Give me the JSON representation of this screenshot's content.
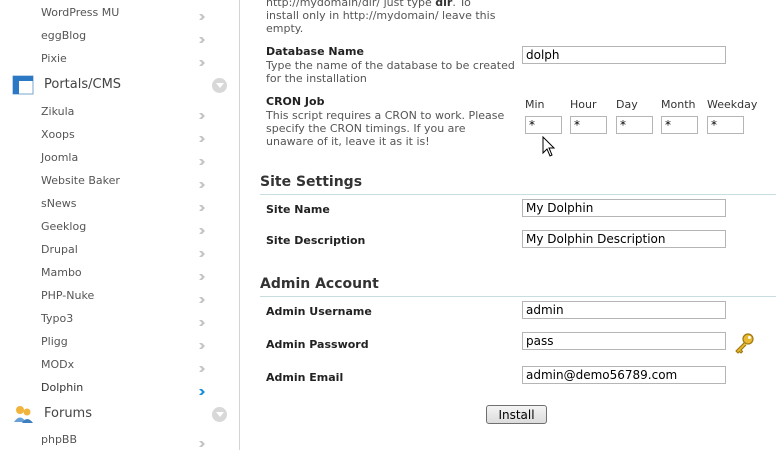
{
  "sidebar": {
    "items_top": [
      {
        "label": "WordPress MU"
      },
      {
        "label": "eggBlog"
      },
      {
        "label": "Pixie"
      }
    ],
    "categories": [
      {
        "label": "Portals/CMS",
        "icon": "portal-icon"
      },
      {
        "label": "Forums",
        "icon": "forums-icon"
      }
    ],
    "portal_items": [
      {
        "label": "Zikula"
      },
      {
        "label": "Xoops"
      },
      {
        "label": "Joomla"
      },
      {
        "label": "Website Baker"
      },
      {
        "label": "sNews"
      },
      {
        "label": "Geeklog"
      },
      {
        "label": "Drupal"
      },
      {
        "label": "Mambo"
      },
      {
        "label": "PHP-Nuke"
      },
      {
        "label": "Typo3"
      },
      {
        "label": "Pligg"
      },
      {
        "label": "MODx"
      },
      {
        "label": "Dolphin"
      }
    ],
    "forum_items": [
      {
        "label": "phpBB"
      }
    ],
    "selected": "Dolphin",
    "selected_arrow_color": "#1e8fd6"
  },
  "main": {
    "dir_desc_line1": "http://mydomain/dir/ just type ",
    "dir_desc_bold": "dir",
    "dir_desc_line1_end": ". To",
    "dir_desc_line2": "install only in http://mydomain/ leave this",
    "dir_desc_line3": "empty.",
    "db": {
      "label": "Database Name",
      "desc": "Type the name of the database to be created for the installation",
      "value": "dolph"
    },
    "cron": {
      "label": "CRON Job",
      "desc": "This script requires a CRON to work. Please specify the CRON timings. If you are unaware of it, leave it as it is!",
      "fields": [
        {
          "label": "Min",
          "value": "*"
        },
        {
          "label": "Hour",
          "value": "*"
        },
        {
          "label": "Day",
          "value": "*"
        },
        {
          "label": "Month",
          "value": "*"
        },
        {
          "label": "Weekday",
          "value": "*"
        }
      ]
    },
    "site_settings": {
      "title": "Site Settings",
      "site_name": {
        "label": "Site Name",
        "value": "My Dolphin"
      },
      "site_desc": {
        "label": "Site Description",
        "value": "My Dolphin Description"
      }
    },
    "admin": {
      "title": "Admin Account",
      "username": {
        "label": "Admin Username",
        "value": "admin"
      },
      "password": {
        "label": "Admin Password",
        "value": "pass"
      },
      "email": {
        "label": "Admin Email",
        "value": "admin@demo56789.com"
      }
    },
    "install_label": "Install"
  },
  "colors": {
    "accent": "#1e8fd6",
    "section_rule": "#c8dde0"
  }
}
